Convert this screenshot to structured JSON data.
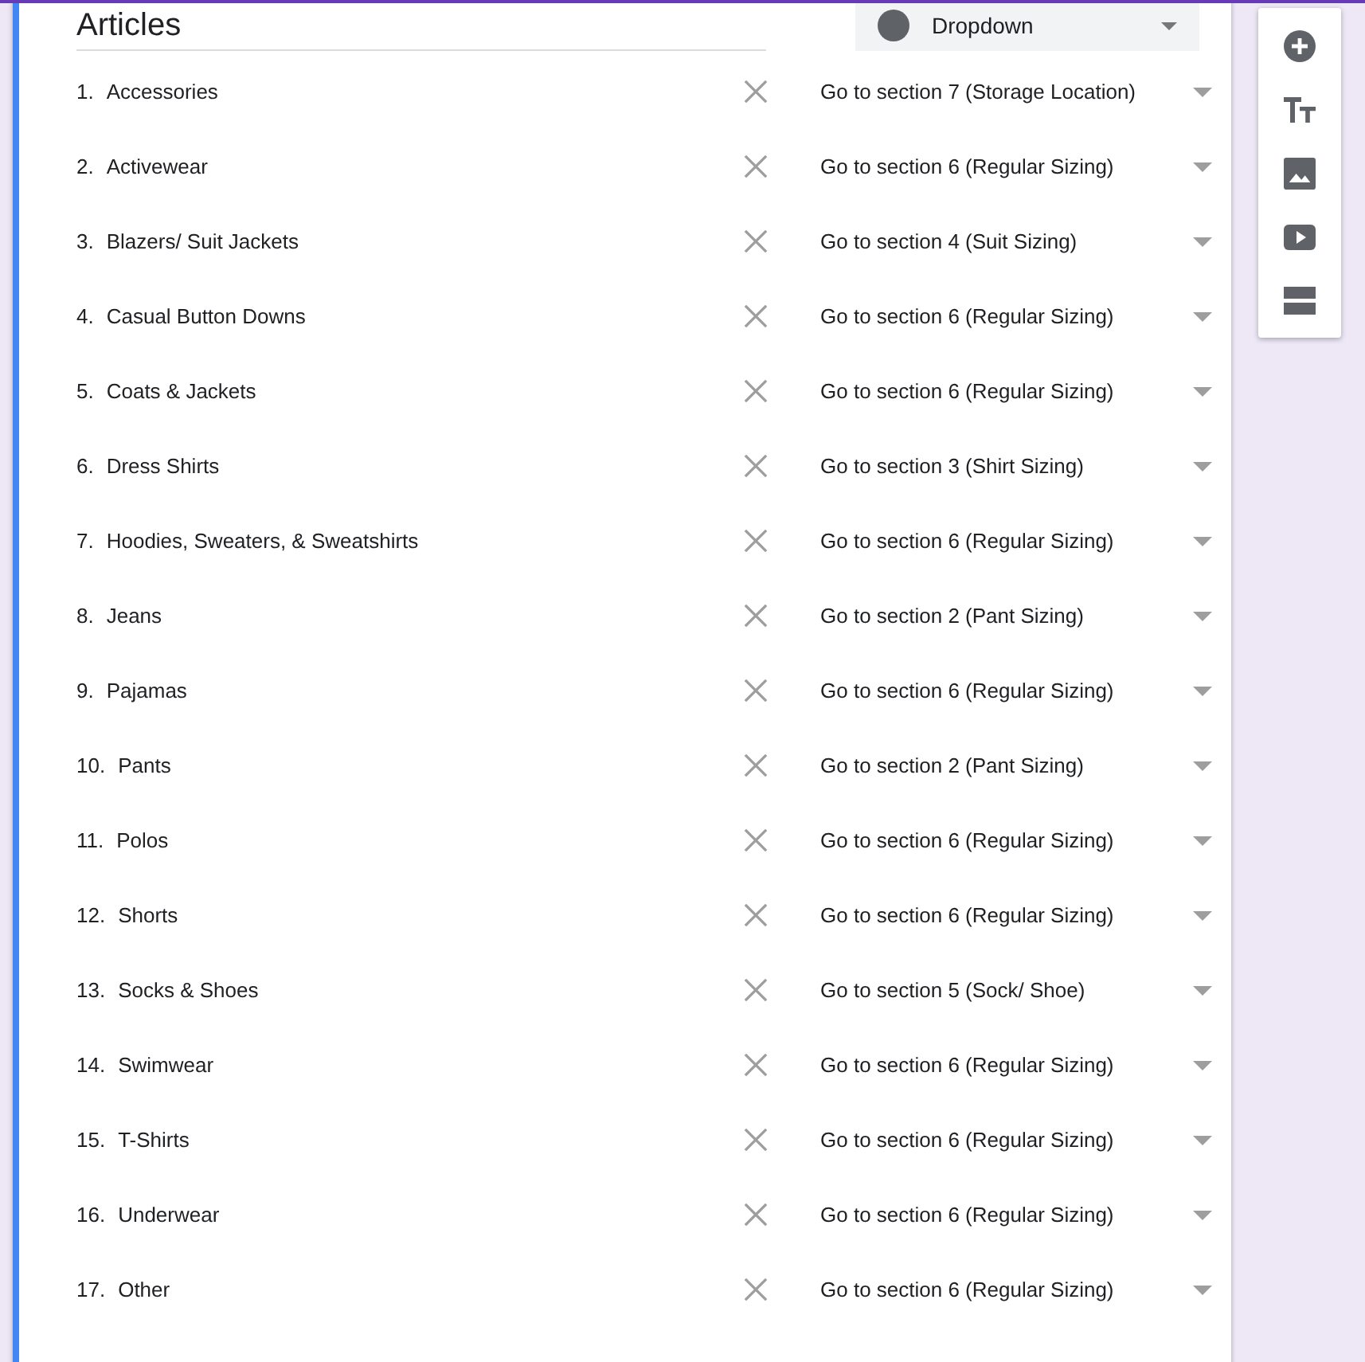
{
  "question": {
    "title": "Articles",
    "type_dropdown": {
      "label": "Dropdown"
    }
  },
  "options": [
    {
      "number": "1.",
      "label": "Accessories",
      "destination": "Go to section 7 (Storage Location)"
    },
    {
      "number": "2.",
      "label": "Activewear",
      "destination": "Go to section 6 (Regular Sizing)"
    },
    {
      "number": "3.",
      "label": "Blazers/ Suit Jackets",
      "destination": "Go to section 4 (Suit Sizing)"
    },
    {
      "number": "4.",
      "label": "Casual Button Downs",
      "destination": "Go to section 6 (Regular Sizing)"
    },
    {
      "number": "5.",
      "label": "Coats & Jackets",
      "destination": "Go to section 6 (Regular Sizing)"
    },
    {
      "number": "6.",
      "label": "Dress Shirts",
      "destination": "Go to section 3 (Shirt Sizing)"
    },
    {
      "number": "7.",
      "label": "Hoodies, Sweaters, & Sweatshirts",
      "destination": "Go to section 6 (Regular Sizing)"
    },
    {
      "number": "8.",
      "label": "Jeans",
      "destination": "Go to section 2 (Pant Sizing)"
    },
    {
      "number": "9.",
      "label": "Pajamas",
      "destination": "Go to section 6 (Regular Sizing)"
    },
    {
      "number": "10.",
      "label": "Pants",
      "destination": "Go to section 2 (Pant Sizing)"
    },
    {
      "number": "11.",
      "label": "Polos",
      "destination": "Go to section 6 (Regular Sizing)"
    },
    {
      "number": "12.",
      "label": "Shorts",
      "destination": "Go to section 6 (Regular Sizing)"
    },
    {
      "number": "13.",
      "label": "Socks & Shoes",
      "destination": "Go to section 5 (Sock/ Shoe)"
    },
    {
      "number": "14.",
      "label": "Swimwear",
      "destination": "Go to section 6 (Regular Sizing)"
    },
    {
      "number": "15.",
      "label": "T-Shirts",
      "destination": "Go to section 6 (Regular Sizing)"
    },
    {
      "number": "16.",
      "label": "Underwear",
      "destination": "Go to section 6 (Regular Sizing)"
    },
    {
      "number": "17.",
      "label": "Other",
      "destination": "Go to section 6 (Regular Sizing)"
    }
  ]
}
